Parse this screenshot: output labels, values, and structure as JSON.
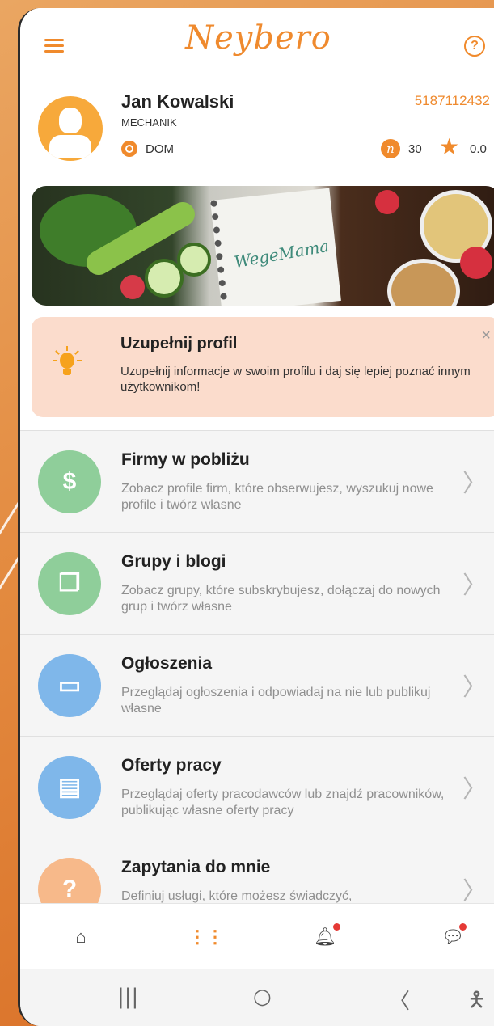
{
  "header": {
    "logo_text": "Neybero",
    "menu_icon": "hamburger-menu-icon",
    "help_icon": "help-circle-icon",
    "help_glyph": "?"
  },
  "profile": {
    "name": "Jan Kowalski",
    "role": "MECHANIK",
    "phone": "5187112432",
    "location": "DOM",
    "points": "30",
    "rating": "0.0",
    "badge_letter": "n"
  },
  "notice": {
    "title": "Uzupełnij profil",
    "text": "Uzupełnij informacje w swoim profilu i daj się lepiej poznać innym użytkownikom!",
    "close": "×"
  },
  "menu": {
    "items": [
      {
        "title": "Firmy w pobliżu",
        "desc": "Zobacz profile firm, które obserwujesz, wyszukuj nowe profile i twórz własne",
        "icon": "company-house-icon",
        "color": "#8fce9a"
      },
      {
        "title": "Grupy i blogi",
        "desc": "Zobacz grupy, które subskrybujesz, dołączaj do nowych grup i twórz własne",
        "icon": "chat-bubbles-icon",
        "color": "#8fce9a"
      },
      {
        "title": "Ogłoszenia",
        "desc": "Przeglądaj ogłoszenia i odpowiadaj na nie lub publikuj własne",
        "icon": "billboard-icon",
        "color": "#7fb7ea"
      },
      {
        "title": "Oferty pracy",
        "desc": "Przeglądaj oferty pracodawców lub znajdź pracowników, publikując własne oferty pracy",
        "icon": "briefcase-icon",
        "color": "#7fb7ea"
      },
      {
        "title": "Zapytania do mnie",
        "desc": "Definiuj usługi, które możesz świadczyć,",
        "icon": "question-icon",
        "color": "#f7b98a"
      }
    ],
    "chevron": "〉"
  },
  "bottom_nav": {
    "items": [
      "home-icon",
      "apps-grid-icon",
      "notifications-bell-icon",
      "messages-icon"
    ],
    "accent": "#f08a2c"
  },
  "system_nav": {
    "recent": "|||",
    "home": "○",
    "back": "〈",
    "accessibility": "accessibility-icon"
  }
}
